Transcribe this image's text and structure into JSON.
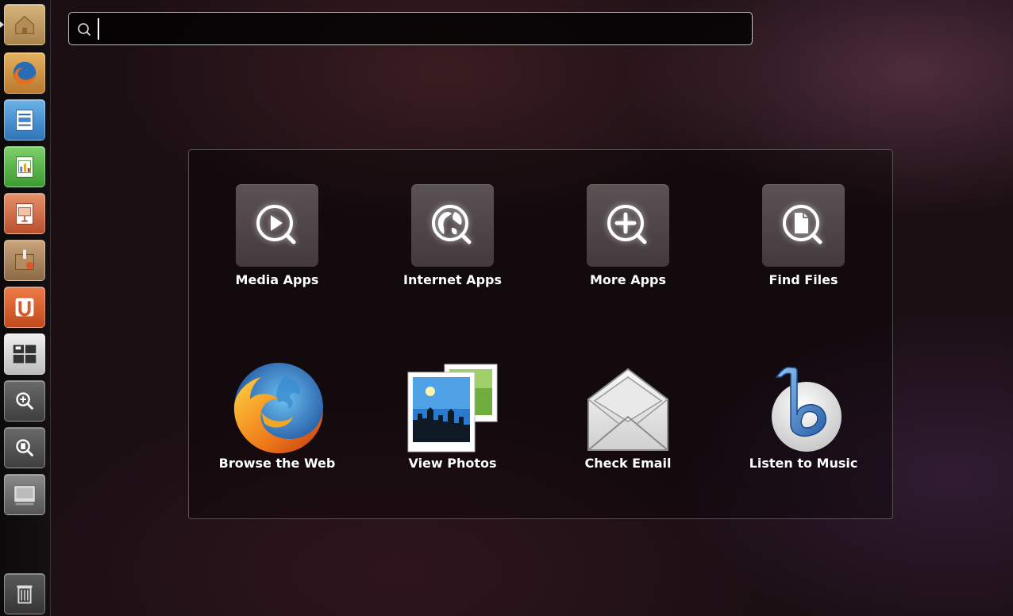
{
  "search": {
    "value": "",
    "placeholder": "",
    "icon": "search-icon"
  },
  "launcher": {
    "items": [
      {
        "name": "home",
        "icon": "home-folder-icon",
        "color": "#c9a268"
      },
      {
        "name": "firefox",
        "icon": "firefox-icon",
        "color": "#d97b2b"
      },
      {
        "name": "writer",
        "icon": "libreoffice-writer-icon",
        "color": "#3a82c4"
      },
      {
        "name": "calc",
        "icon": "libreoffice-calc-icon",
        "color": "#4ea53a"
      },
      {
        "name": "impress",
        "icon": "libreoffice-impress-icon",
        "color": "#c55a3a"
      },
      {
        "name": "package-installer",
        "icon": "package-box-icon",
        "color": "#9e7c55"
      },
      {
        "name": "ubuntu-one",
        "icon": "ubuntu-one-icon",
        "color": "#d85a2a"
      },
      {
        "name": "workspace-switcher",
        "icon": "workspaces-icon",
        "color": "#cfcfcf"
      },
      {
        "name": "applications-lens",
        "icon": "apps-search-icon",
        "color": "#555555"
      },
      {
        "name": "files-lens",
        "icon": "files-search-icon",
        "color": "#555555"
      },
      {
        "name": "computer",
        "icon": "computer-icon",
        "color": "#888888"
      },
      {
        "name": "trash",
        "icon": "trash-icon",
        "color": "#555555"
      }
    ]
  },
  "lenses": [
    {
      "label": "Media Apps",
      "icon": "media-play-search-icon"
    },
    {
      "label": "Internet Apps",
      "icon": "globe-search-icon"
    },
    {
      "label": "More Apps",
      "icon": "plus-search-icon"
    },
    {
      "label": "Find Files",
      "icon": "file-search-icon"
    }
  ],
  "shortcuts": [
    {
      "label": "Browse the Web",
      "icon": "firefox-icon"
    },
    {
      "label": "View Photos",
      "icon": "photos-icon"
    },
    {
      "label": "Check Email",
      "icon": "envelope-icon"
    },
    {
      "label": "Listen to Music",
      "icon": "banshee-music-icon"
    }
  ]
}
